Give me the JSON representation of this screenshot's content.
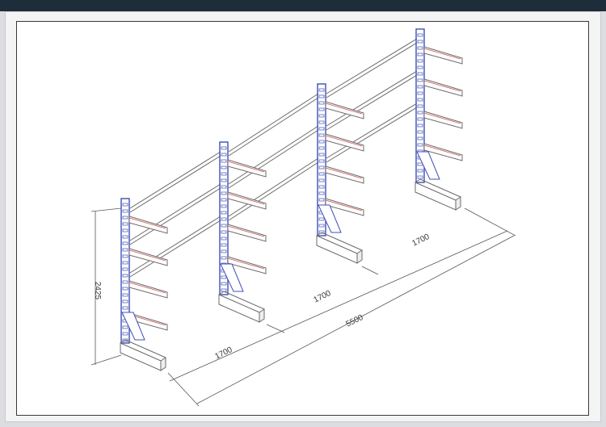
{
  "colors": {
    "header_bar": "#1f2c39",
    "upright_blue": "#3f4fb5",
    "arm_red": "#c8554f",
    "line": "#6b6b6b",
    "paper": "#ffffff"
  },
  "dimensions": {
    "height_label": "2425",
    "bay_1": "1700",
    "bay_2": "1700",
    "bay_3": "1700",
    "overall_length": "5500"
  }
}
